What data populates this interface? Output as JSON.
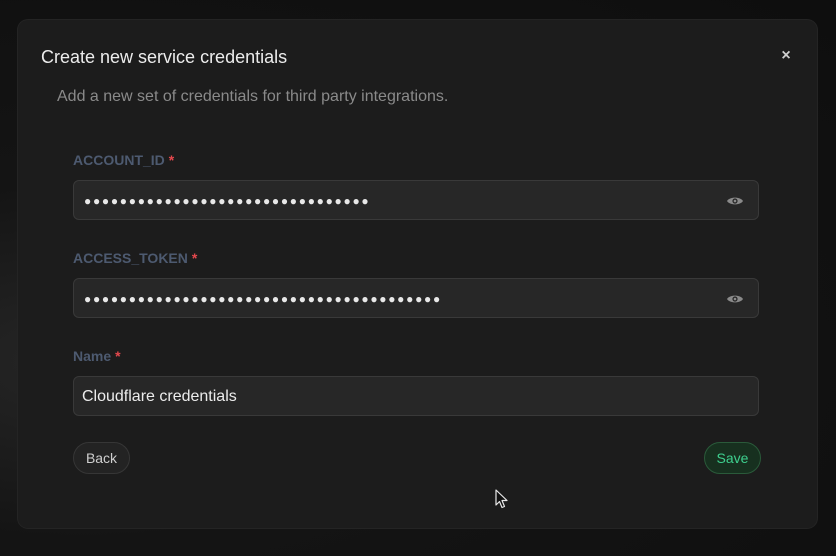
{
  "dialog": {
    "title": "Create new service credentials",
    "subtitle": "Add a new set of credentials for third party integrations.",
    "close_icon": "×"
  },
  "fields": {
    "account_id": {
      "label": "ACCOUNT_ID",
      "required_mark": "*",
      "masked_value": "●●●●●●●●●●●●●●●●●●●●●●●●●●●●●●●●"
    },
    "access_token": {
      "label": "ACCESS_TOKEN",
      "required_mark": "*",
      "masked_value": "●●●●●●●●●●●●●●●●●●●●●●●●●●●●●●●●●●●●●●●●"
    },
    "name": {
      "label": "Name",
      "required_mark": "*",
      "value": "Cloudflare credentials"
    }
  },
  "buttons": {
    "back_label": "Back",
    "save_label": "Save"
  },
  "colors": {
    "accent": "#3ecf8e",
    "required": "#e5484d",
    "label": "#4d5a70"
  }
}
